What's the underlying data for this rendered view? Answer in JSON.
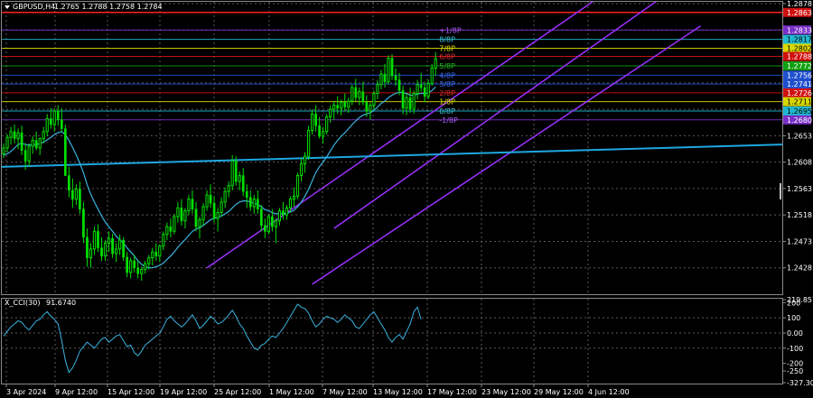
{
  "header": {
    "symbol": "GBPUSD,H4",
    "quote": "1.2765 1.2788 1.2758 1.2784"
  },
  "indicator_header": {
    "name": "X_CCI(30)",
    "value": "91.6740"
  },
  "colors": {
    "background": "#000000",
    "bull": "#00e000",
    "ema_short": "#3bb3e0",
    "ema_long": "#1ea7e0",
    "channel": "#9b30ff",
    "grid": "#5a5a5a",
    "cci": "#3bb3e0"
  },
  "chart_data": [
    {
      "type": "candlestick",
      "ylim": [
        1.2383,
        1.2878
      ],
      "ticks": [
        "1.2878",
        "1.2833",
        "1.2788",
        "1.2743",
        "1.2698",
        "1.2653",
        "1.2608",
        "1.2563",
        "1.2518",
        "1.2473",
        "1.2428"
      ],
      "tick_values": [
        1.2878,
        1.2833,
        1.2788,
        1.2743,
        1.2698,
        1.2653,
        1.2608,
        1.2563,
        1.2518,
        1.2473,
        1.2428
      ],
      "x_labels": [
        "3 Apr 2024",
        "9 Apr 12:00",
        "15 Apr 12:00",
        "19 Apr 12:00",
        "25 Apr 12:00",
        "1 May 12:00",
        "7 May 12:00",
        "13 May 12:00",
        "17 May 12:00",
        "23 May 12:00",
        "29 May 12:00",
        "4 Jun 12:00"
      ],
      "price_tags": [
        {
          "text": "1.2863",
          "value": 1.2863,
          "bg": "#d01010",
          "fg": "#ffffff"
        },
        {
          "text": "1.2833",
          "value": 1.2833,
          "bg": "#7a30c8",
          "fg": "#ffffff"
        },
        {
          "text": "1.2817",
          "value": 1.2817,
          "bg": "#20b8d0",
          "fg": "#000000"
        },
        {
          "text": "1.2802",
          "value": 1.2802,
          "bg": "#d8d800",
          "fg": "#000000"
        },
        {
          "text": "1.2788",
          "value": 1.2788,
          "bg": "#d01010",
          "fg": "#ffffff"
        },
        {
          "text": "1.2772",
          "value": 1.2772,
          "bg": "#10a010",
          "fg": "#ffffff"
        },
        {
          "text": "1.2756",
          "value": 1.2756,
          "bg": "#2050d0",
          "fg": "#ffffff"
        },
        {
          "text": "1.2741",
          "value": 1.2741,
          "bg": "#2050d0",
          "fg": "#ffffff"
        },
        {
          "text": "1.2726",
          "value": 1.2726,
          "bg": "#d01010",
          "fg": "#ffffff"
        },
        {
          "text": "1.2711",
          "value": 1.2711,
          "bg": "#d8d800",
          "fg": "#000000"
        },
        {
          "text": "1.2695",
          "value": 1.2695,
          "bg": "#20b8d0",
          "fg": "#000000"
        },
        {
          "text": "1.2680",
          "value": 1.268,
          "bg": "#7a30c8",
          "fg": "#ffffff"
        }
      ],
      "murrey_labels": [
        {
          "text": "+1/8P",
          "value": 1.2833,
          "color": "#b060ff"
        },
        {
          "text": "8/8P",
          "value": 1.2817,
          "color": "#40c8e0"
        },
        {
          "text": "7/8P",
          "value": 1.2802,
          "color": "#e0e000"
        },
        {
          "text": "6/8P",
          "value": 1.2788,
          "color": "#e03030"
        },
        {
          "text": "5/8P",
          "value": 1.2772,
          "color": "#20c020"
        },
        {
          "text": "4/8P",
          "value": 1.2756,
          "color": "#4070ff"
        },
        {
          "text": "3/8P",
          "value": 1.2741,
          "color": "#4070ff"
        },
        {
          "text": "2/8P",
          "value": 1.2726,
          "color": "#e03030"
        },
        {
          "text": "1/8P",
          "value": 1.2711,
          "color": "#e0e000"
        },
        {
          "text": "0/8P",
          "value": 1.2695,
          "color": "#40c8e0"
        },
        {
          "text": "-1/8P",
          "value": 1.268,
          "color": "#b060ff"
        }
      ],
      "candles": [
        [
          1.2622,
          1.264,
          1.2615,
          1.2632
        ],
        [
          1.2632,
          1.2655,
          1.2625,
          1.265
        ],
        [
          1.265,
          1.2668,
          1.2638,
          1.266
        ],
        [
          1.266,
          1.2672,
          1.264,
          1.2648
        ],
        [
          1.2648,
          1.2665,
          1.263,
          1.2658
        ],
        [
          1.2658,
          1.267,
          1.262,
          1.2628
        ],
        [
          1.2628,
          1.264,
          1.2595,
          1.261
        ],
        [
          1.261,
          1.264,
          1.26,
          1.2635
        ],
        [
          1.2635,
          1.2652,
          1.2622,
          1.2645
        ],
        [
          1.2645,
          1.266,
          1.2628,
          1.2632
        ],
        [
          1.2632,
          1.265,
          1.262,
          1.2648
        ],
        [
          1.2648,
          1.2668,
          1.264,
          1.266
        ],
        [
          1.266,
          1.269,
          1.2652,
          1.2682
        ],
        [
          1.2682,
          1.27,
          1.2665,
          1.2672
        ],
        [
          1.2672,
          1.27,
          1.266,
          1.2695
        ],
        [
          1.2695,
          1.2705,
          1.267,
          1.268
        ],
        [
          1.268,
          1.27,
          1.266,
          1.2665
        ],
        [
          1.2665,
          1.2672,
          1.26,
          1.2585
        ],
        [
          1.2585,
          1.26,
          1.2548,
          1.256
        ],
        [
          1.256,
          1.258,
          1.253,
          1.2545
        ],
        [
          1.2545,
          1.257,
          1.2535,
          1.2562
        ],
        [
          1.2562,
          1.2575,
          1.252,
          1.2528
        ],
        [
          1.2528,
          1.254,
          1.247,
          1.248
        ],
        [
          1.248,
          1.2495,
          1.243,
          1.2445
        ],
        [
          1.2445,
          1.247,
          1.2428,
          1.246
        ],
        [
          1.246,
          1.2498,
          1.245,
          1.249
        ],
        [
          1.249,
          1.2502,
          1.2455,
          1.2462
        ],
        [
          1.2462,
          1.248,
          1.244,
          1.2448
        ],
        [
          1.2448,
          1.2475,
          1.244,
          1.247
        ],
        [
          1.247,
          1.249,
          1.2455,
          1.2478
        ],
        [
          1.2478,
          1.2486,
          1.2445,
          1.2452
        ],
        [
          1.2452,
          1.247,
          1.2438,
          1.246
        ],
        [
          1.246,
          1.2485,
          1.245,
          1.2475
        ],
        [
          1.2475,
          1.248,
          1.244,
          1.2446
        ],
        [
          1.2446,
          1.2455,
          1.2412,
          1.242
        ],
        [
          1.242,
          1.2445,
          1.241,
          1.244
        ],
        [
          1.244,
          1.245,
          1.242,
          1.2428
        ],
        [
          1.2428,
          1.244,
          1.241,
          1.2418
        ],
        [
          1.2418,
          1.243,
          1.2406,
          1.2425
        ],
        [
          1.2425,
          1.244,
          1.2418,
          1.2435
        ],
        [
          1.2435,
          1.245,
          1.2425,
          1.2445
        ],
        [
          1.2445,
          1.2462,
          1.2432,
          1.2455
        ],
        [
          1.2455,
          1.247,
          1.244,
          1.2448
        ],
        [
          1.2448,
          1.2468,
          1.2438,
          1.2465
        ],
        [
          1.2465,
          1.249,
          1.2458,
          1.2485
        ],
        [
          1.2485,
          1.2505,
          1.2475,
          1.2498
        ],
        [
          1.2498,
          1.2512,
          1.248,
          1.249
        ],
        [
          1.249,
          1.252,
          1.2485,
          1.2515
        ],
        [
          1.2515,
          1.254,
          1.2505,
          1.253
        ],
        [
          1.253,
          1.2545,
          1.25,
          1.2508
        ],
        [
          1.2508,
          1.253,
          1.2495,
          1.2525
        ],
        [
          1.2525,
          1.2552,
          1.2518,
          1.2545
        ],
        [
          1.2545,
          1.256,
          1.252,
          1.2528
        ],
        [
          1.2528,
          1.254,
          1.249,
          1.2498
        ],
        [
          1.2498,
          1.2515,
          1.2478,
          1.251
        ],
        [
          1.251,
          1.2538,
          1.25,
          1.2532
        ],
        [
          1.2532,
          1.256,
          1.2525,
          1.2552
        ],
        [
          1.2552,
          1.257,
          1.253,
          1.2538
        ],
        [
          1.2538,
          1.255,
          1.2505,
          1.2512
        ],
        [
          1.2512,
          1.253,
          1.249,
          1.2522
        ],
        [
          1.2522,
          1.2548,
          1.2515,
          1.254
        ],
        [
          1.254,
          1.2565,
          1.253,
          1.2558
        ],
        [
          1.2558,
          1.2575,
          1.2548,
          1.2568
        ],
        [
          1.2568,
          1.262,
          1.256,
          1.261
        ],
        [
          1.261,
          1.2618,
          1.2568,
          1.2575
        ],
        [
          1.2575,
          1.2592,
          1.256,
          1.2585
        ],
        [
          1.2585,
          1.2598,
          1.255,
          1.2558
        ],
        [
          1.2558,
          1.257,
          1.253,
          1.2548
        ],
        [
          1.2548,
          1.256,
          1.2525,
          1.2532
        ],
        [
          1.2532,
          1.2552,
          1.252,
          1.2545
        ],
        [
          1.2545,
          1.256,
          1.252,
          1.2528
        ],
        [
          1.2528,
          1.2535,
          1.249,
          1.25
        ],
        [
          1.25,
          1.2512,
          1.2478,
          1.249
        ],
        [
          1.249,
          1.252,
          1.2485,
          1.2515
        ],
        [
          1.2515,
          1.2528,
          1.249,
          1.2498
        ],
        [
          1.2498,
          1.2512,
          1.247,
          1.2508
        ],
        [
          1.2508,
          1.253,
          1.25,
          1.2525
        ],
        [
          1.2525,
          1.254,
          1.251,
          1.2518
        ],
        [
          1.2518,
          1.2535,
          1.251,
          1.253
        ],
        [
          1.253,
          1.255,
          1.2522,
          1.2545
        ],
        [
          1.2545,
          1.2565,
          1.2532,
          1.255
        ],
        [
          1.255,
          1.259,
          1.2545,
          1.2585
        ],
        [
          1.2585,
          1.2615,
          1.2575,
          1.2605
        ],
        [
          1.2605,
          1.2625,
          1.259,
          1.2618
        ],
        [
          1.2618,
          1.267,
          1.2612,
          1.2662
        ],
        [
          1.2662,
          1.2698,
          1.2655,
          1.269
        ],
        [
          1.269,
          1.2705,
          1.266,
          1.267
        ],
        [
          1.267,
          1.2685,
          1.2648,
          1.2652
        ],
        [
          1.2652,
          1.2668,
          1.264,
          1.266
        ],
        [
          1.266,
          1.269,
          1.2655,
          1.2685
        ],
        [
          1.2685,
          1.2705,
          1.2675,
          1.2698
        ],
        [
          1.2698,
          1.2712,
          1.268,
          1.2705
        ],
        [
          1.2705,
          1.272,
          1.269,
          1.27
        ],
        [
          1.27,
          1.2715,
          1.2688,
          1.271
        ],
        [
          1.271,
          1.2725,
          1.2695,
          1.2702
        ],
        [
          1.2702,
          1.2718,
          1.2692,
          1.2712
        ],
        [
          1.2712,
          1.274,
          1.2705,
          1.2735
        ],
        [
          1.2735,
          1.275,
          1.2712,
          1.2718
        ],
        [
          1.2718,
          1.2735,
          1.2705,
          1.2728
        ],
        [
          1.2728,
          1.2745,
          1.2705,
          1.271
        ],
        [
          1.271,
          1.2722,
          1.2685,
          1.2695
        ],
        [
          1.2695,
          1.271,
          1.268,
          1.2705
        ],
        [
          1.2705,
          1.273,
          1.2698,
          1.2725
        ],
        [
          1.2725,
          1.2748,
          1.2715,
          1.274
        ],
        [
          1.274,
          1.2765,
          1.2732,
          1.2758
        ],
        [
          1.2758,
          1.2775,
          1.2735,
          1.2745
        ],
        [
          1.2745,
          1.279,
          1.274,
          1.2785
        ],
        [
          1.2785,
          1.2792,
          1.2748,
          1.2755
        ],
        [
          1.2755,
          1.2768,
          1.2738,
          1.2748
        ],
        [
          1.2748,
          1.276,
          1.2722,
          1.273
        ],
        [
          1.273,
          1.2738,
          1.269,
          1.27
        ],
        [
          1.27,
          1.2725,
          1.2688,
          1.2718
        ],
        [
          1.2718,
          1.2735,
          1.2692,
          1.2698
        ],
        [
          1.2698,
          1.273,
          1.269,
          1.2725
        ],
        [
          1.2725,
          1.2748,
          1.2715,
          1.274
        ],
        [
          1.274,
          1.276,
          1.2728,
          1.2735
        ],
        [
          1.2735,
          1.2745,
          1.271,
          1.272
        ],
        [
          1.272,
          1.2748,
          1.2715,
          1.2742
        ],
        [
          1.2742,
          1.2775,
          1.2738,
          1.2768
        ],
        [
          1.2768,
          1.2795,
          1.2755,
          1.2784
        ]
      ],
      "ema_short": [
        1.262,
        1.2622,
        1.2626,
        1.2632,
        1.2638,
        1.264,
        1.2638,
        1.2637,
        1.2638,
        1.2638,
        1.264,
        1.2642,
        1.2646,
        1.265,
        1.2655,
        1.2658,
        1.266,
        1.2655,
        1.2645,
        1.2633,
        1.262,
        1.2606,
        1.259,
        1.257,
        1.2553,
        1.254,
        1.2528,
        1.2516,
        1.2506,
        1.2498,
        1.249,
        1.2482,
        1.2476,
        1.247,
        1.2462,
        1.2455,
        1.2448,
        1.244,
        1.2434,
        1.243,
        1.2428,
        1.2428,
        1.243,
        1.2432,
        1.2436,
        1.2442,
        1.2448,
        1.2455,
        1.2463,
        1.247,
        1.2476,
        1.2483,
        1.249,
        1.2494,
        1.2496,
        1.25,
        1.2505,
        1.251,
        1.2512,
        1.2514,
        1.2516,
        1.252,
        1.2524,
        1.253,
        1.2536,
        1.254,
        1.2542,
        1.2542,
        1.254,
        1.2538,
        1.2536,
        1.2532,
        1.2527,
        1.2525,
        1.2522,
        1.252,
        1.252,
        1.252,
        1.2521,
        1.2523,
        1.2526,
        1.2532,
        1.254,
        1.255,
        1.2562,
        1.2576,
        1.259,
        1.26,
        1.2608,
        1.2617,
        1.2627,
        1.2637,
        1.2645,
        1.2652,
        1.2658,
        1.2665,
        1.2672,
        1.2678,
        1.2684,
        1.2688,
        1.269,
        1.2692,
        1.2696,
        1.2702,
        1.2708,
        1.2712,
        1.2718,
        1.2722,
        1.2725,
        1.2727,
        1.2726,
        1.2725,
        1.2722,
        1.2722,
        1.2724,
        1.2725,
        1.2725,
        1.2726,
        1.273,
        1.2736
      ],
      "ema_long": [
        1.26,
        1.2638
      ],
      "channel_lines": [
        {
          "p1": [
            91,
            1.2495
          ],
          "p2": [
            192,
            1.2935
          ]
        },
        {
          "p1": [
            56,
            1.2428
          ],
          "p2": [
            192,
            1.3008
          ]
        },
        {
          "p1": [
            85,
            1.24
          ],
          "p2": [
            192,
            1.284
          ]
        }
      ],
      "xlim": [
        0,
        215
      ]
    },
    {
      "type": "line",
      "name": "X_CCI(30)",
      "ylim": [
        -327.3,
        219.9
      ],
      "ticks": [
        "219.857",
        "200",
        "100",
        "0.00",
        "-100",
        "-200",
        "-250",
        "-327.3082"
      ],
      "tick_values": [
        219.857,
        200,
        100,
        0,
        -100,
        -200,
        -250,
        -327.3082
      ],
      "grid_values": [
        100,
        0,
        -100
      ],
      "values": [
        -20,
        10,
        40,
        60,
        80,
        70,
        40,
        20,
        50,
        80,
        90,
        120,
        140,
        110,
        90,
        60,
        -50,
        -180,
        -260,
        -230,
        -180,
        -120,
        -90,
        -60,
        -80,
        -100,
        -70,
        -40,
        -30,
        -60,
        -40,
        -20,
        -10,
        -50,
        -90,
        -80,
        -130,
        -150,
        -120,
        -80,
        -60,
        -40,
        -20,
        0,
        40,
        90,
        110,
        80,
        60,
        40,
        60,
        90,
        120,
        80,
        30,
        50,
        80,
        110,
        90,
        60,
        70,
        90,
        120,
        150,
        110,
        60,
        30,
        -20,
        -60,
        -100,
        -110,
        -80,
        -70,
        -40,
        -20,
        -30,
        0,
        30,
        70,
        110,
        150,
        190,
        170,
        160,
        130,
        80,
        40,
        60,
        90,
        110,
        100,
        90,
        70,
        90,
        120,
        100,
        80,
        40,
        30,
        60,
        90,
        120,
        140,
        100,
        60,
        20,
        -30,
        -60,
        -30,
        -10,
        -40,
        10,
        60,
        140,
        170,
        91.674
      ],
      "xlim": [
        0,
        215
      ]
    }
  ]
}
